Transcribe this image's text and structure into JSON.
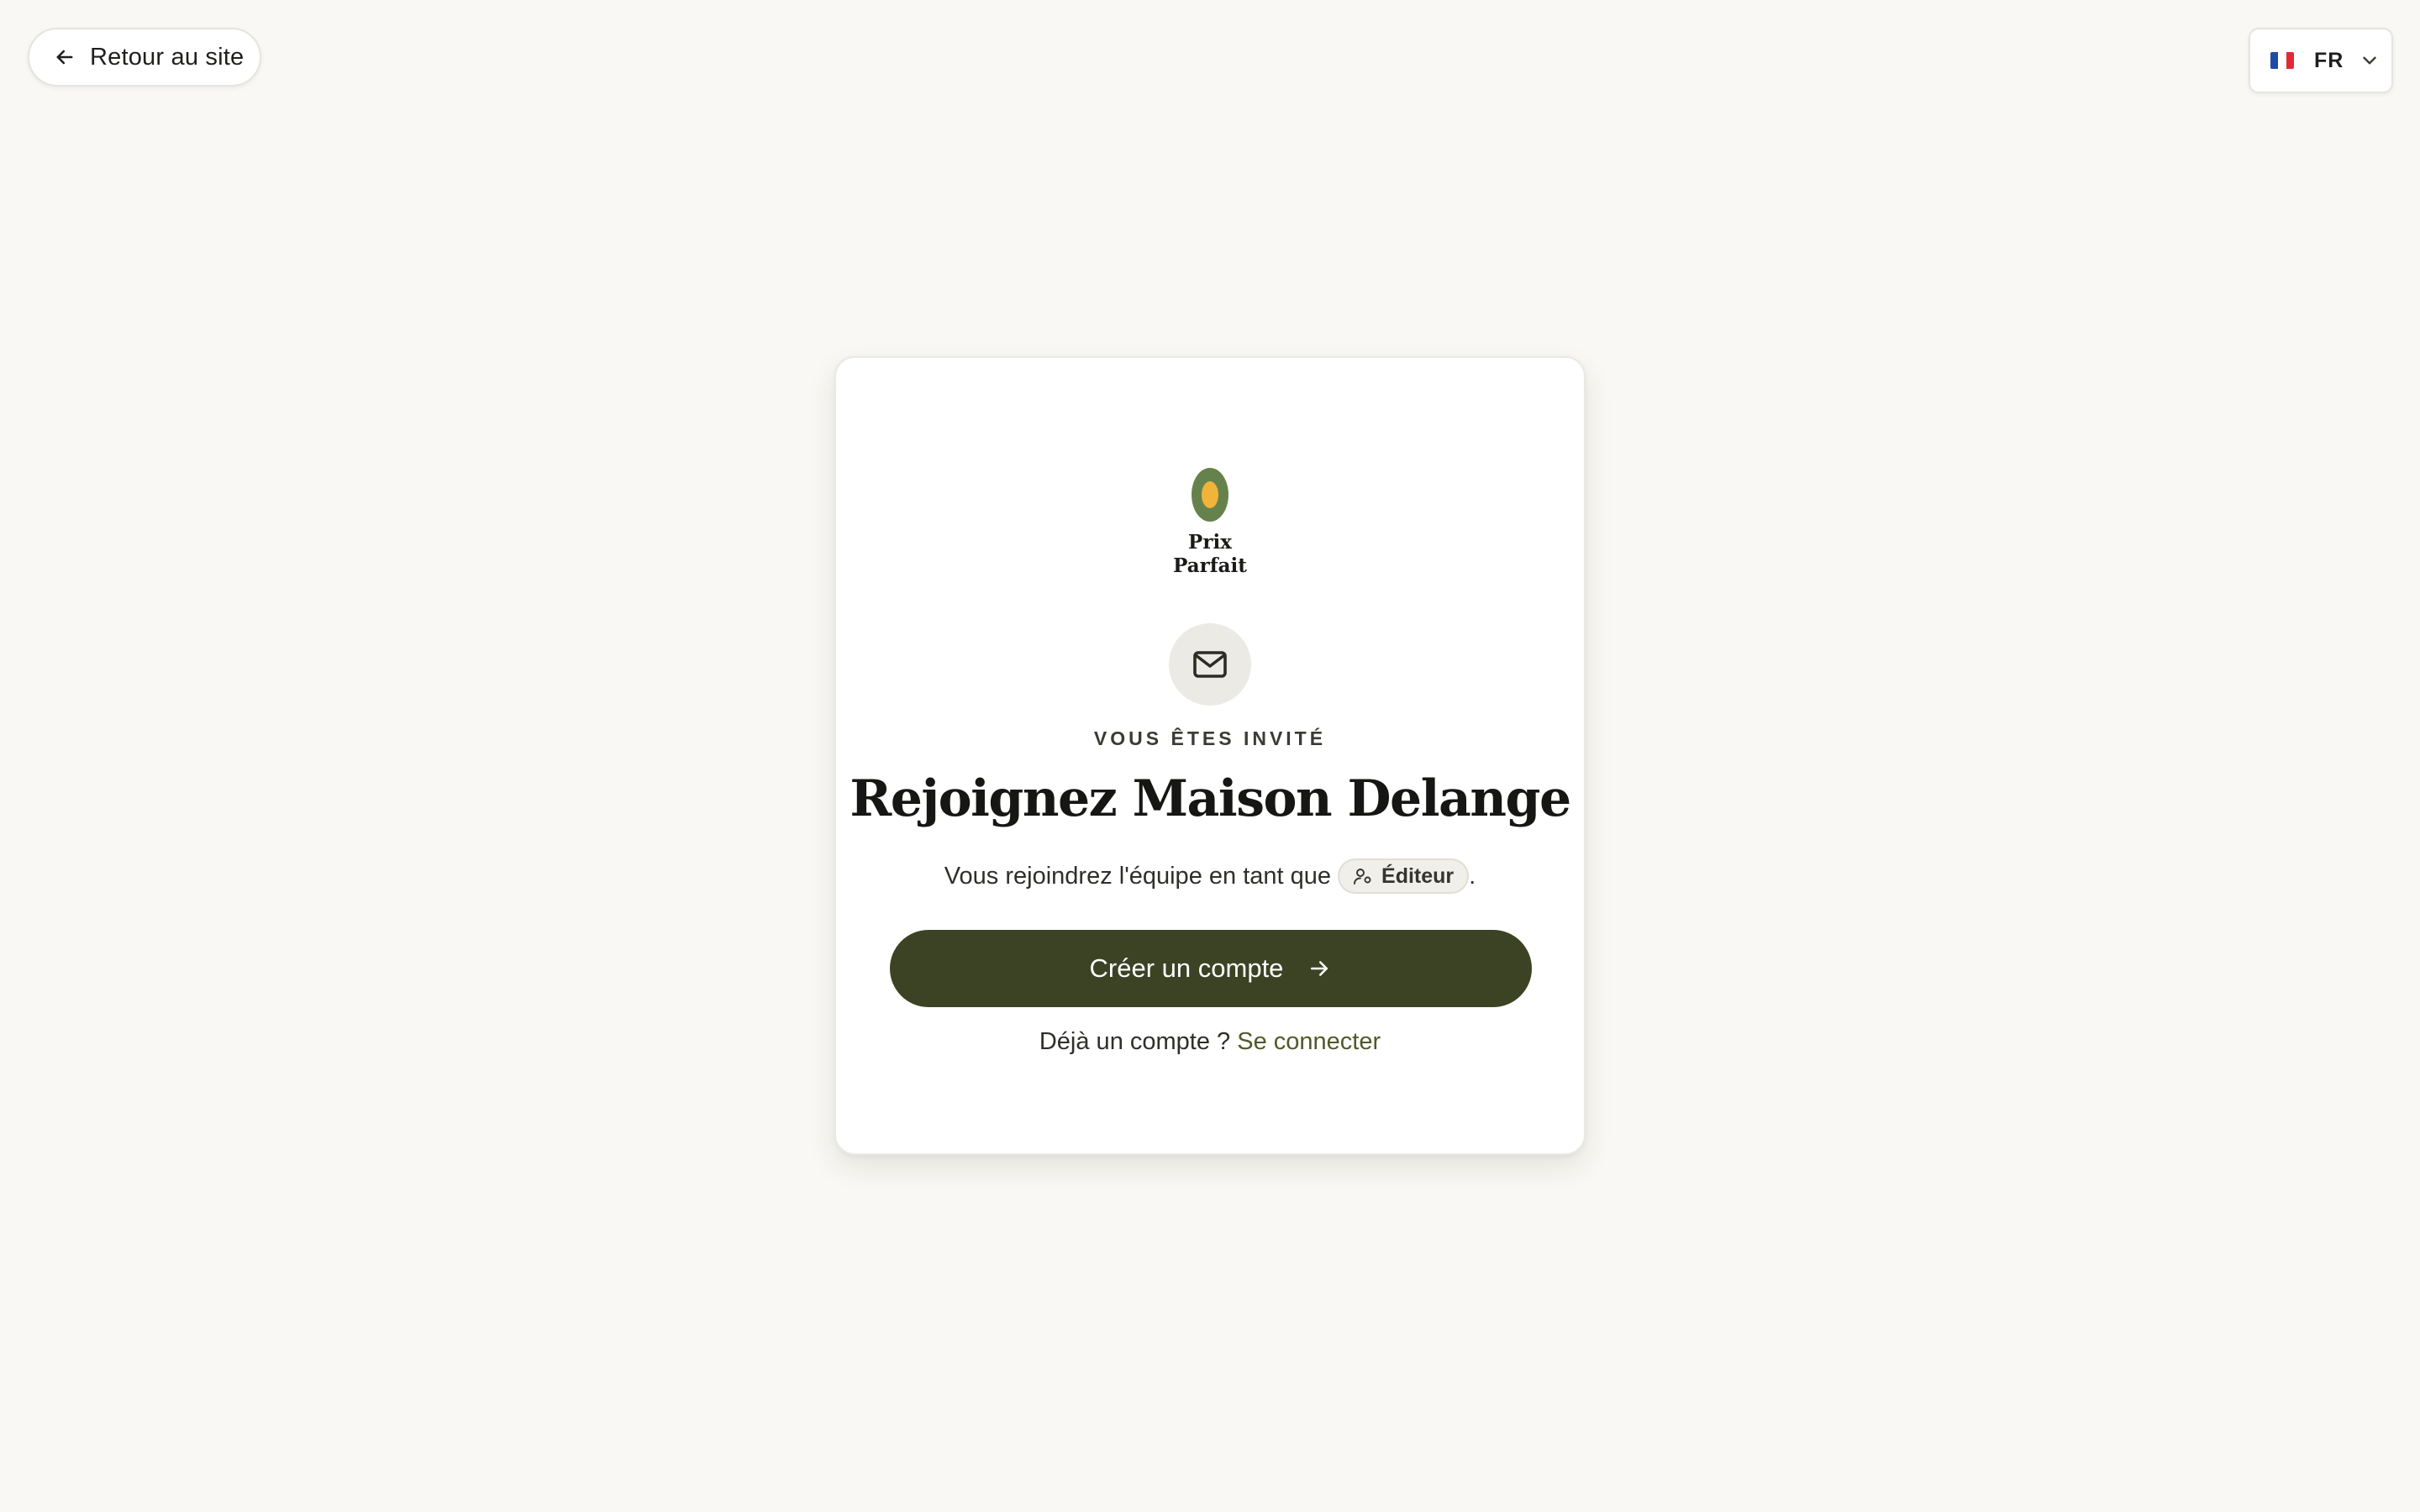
{
  "topbar": {
    "back_label": "Retour au site",
    "back_icon": "arrow-left-icon",
    "language": {
      "code": "FR",
      "flag": "france-flag-icon",
      "flag_colors": [
        "#1f4aa8",
        "#ffffff",
        "#e02b37"
      ],
      "chevron": "chevron-down-icon"
    }
  },
  "brand": {
    "name_line1": "Prix",
    "name_line2": "Parfait",
    "logo_icon": "olive-logo-icon",
    "colors": {
      "olive_outer": "#66824c",
      "olive_inner": "#f2b33a"
    }
  },
  "invite": {
    "icon": "mail-icon",
    "eyebrow": "VOUS ÊTES INVITÉ",
    "title": "Rejoignez Maison Delange",
    "subtitle_prefix": "Vous rejoindrez l'équipe en tant que",
    "role": "Éditeur",
    "role_icon": "user-role-icon",
    "subtitle_suffix": "."
  },
  "cta": {
    "label": "Créer un compte",
    "icon": "arrow-right-icon",
    "color": "#3c4324"
  },
  "footer": {
    "prompt": "Déjà un compte ?",
    "link": "Se connecter",
    "link_color": "#4f5a2a"
  },
  "theme": {
    "background": "#f9f8f4",
    "card": "#ffffff"
  }
}
